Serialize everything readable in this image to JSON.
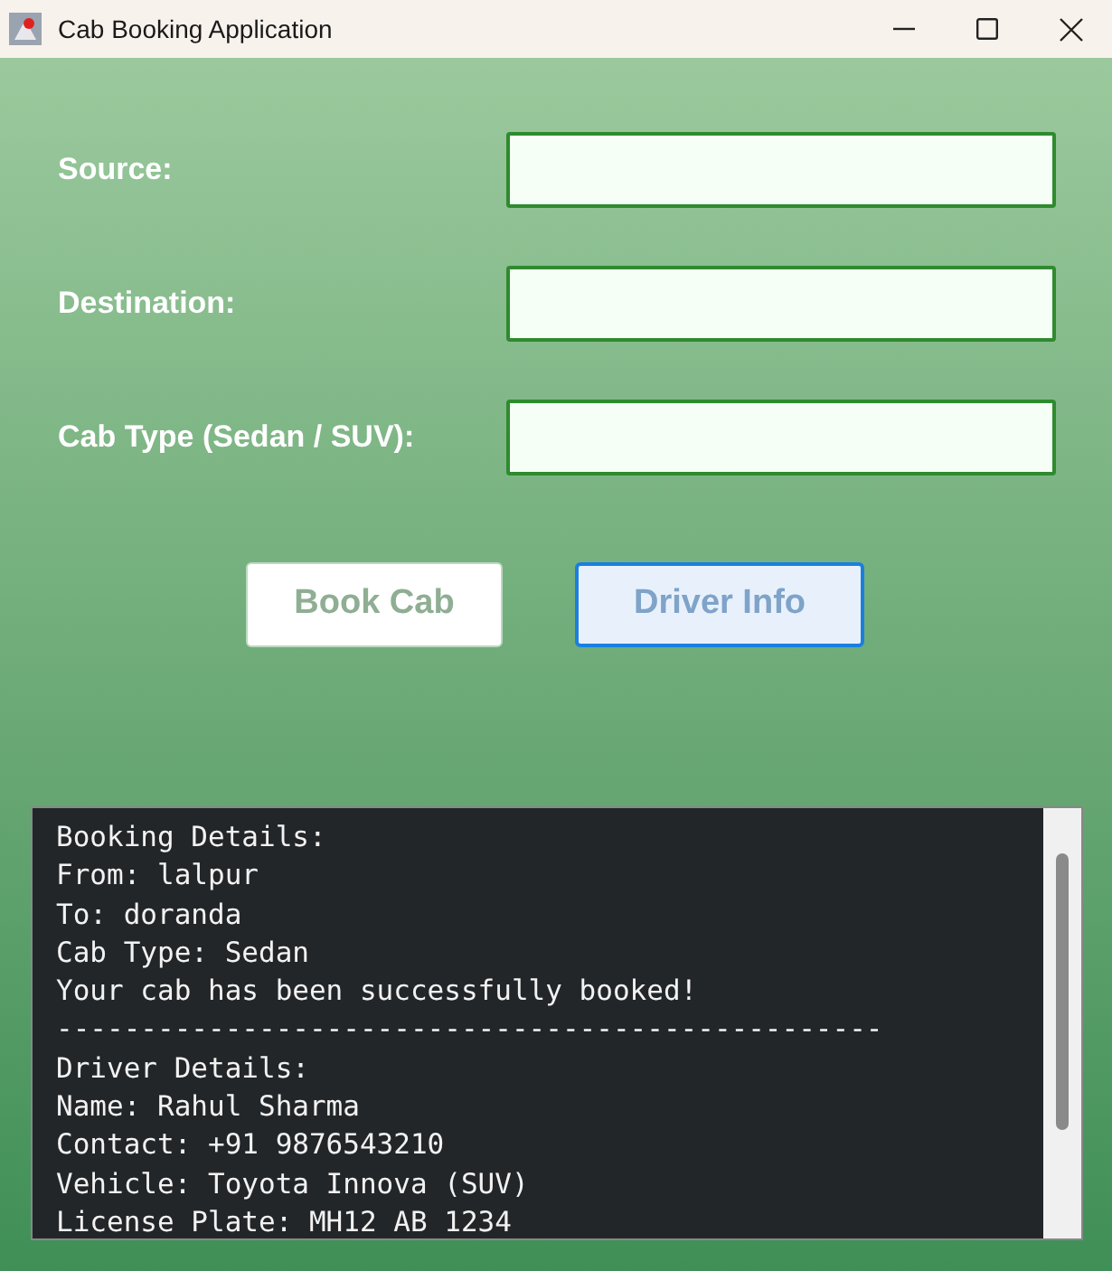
{
  "window": {
    "title": "Cab Booking Application"
  },
  "form": {
    "fields": [
      {
        "label": "Source:"
      },
      {
        "label": "Destination:"
      },
      {
        "label": "Cab Type (Sedan / SUV):"
      }
    ]
  },
  "buttons": [
    {
      "label": "Book Cab",
      "focused": false
    },
    {
      "label": "Driver Info",
      "focused": true
    }
  ],
  "output": {
    "lines": [
      "Booking Details:",
      "From: lalpur",
      "To: doranda",
      "Cab Type: Sedan",
      "Your cab has been successfully booked!",
      "-------------------------------------------------",
      "Driver Details:",
      "Name: Rahul Sharma",
      "Contact: +91 9876543210",
      "Vehicle: Toyota Innova (SUV)",
      "License Plate: MH12 AB 1234"
    ]
  }
}
